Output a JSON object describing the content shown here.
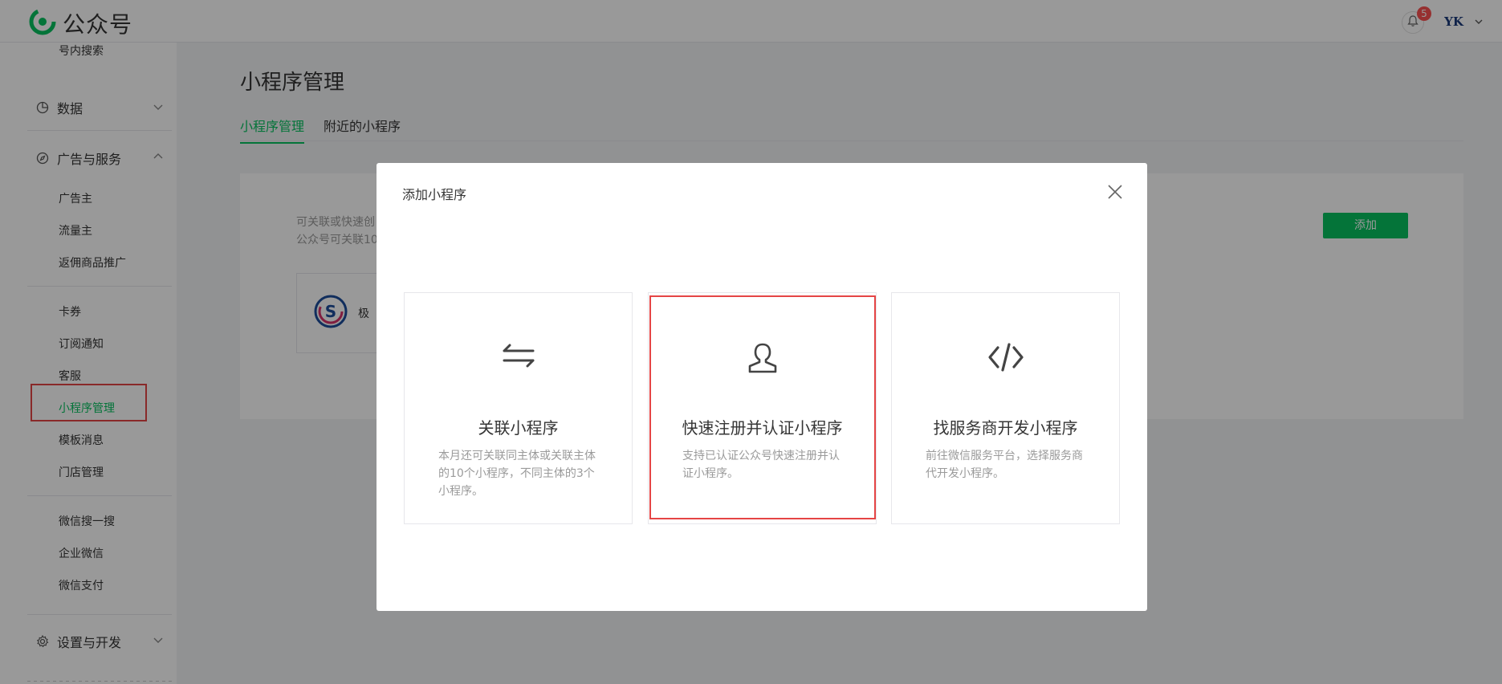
{
  "app": {
    "title": "公众号"
  },
  "header": {
    "notification_count": "5",
    "avatar_text": "YK"
  },
  "sidebar": {
    "top_item": "号内搜索",
    "groups": [
      {
        "label": "数据",
        "icon": "pie-chart-icon"
      },
      {
        "label": "广告与服务",
        "icon": "compass-icon"
      },
      {
        "label": "设置与开发",
        "icon": "gear-icon"
      }
    ],
    "items": [
      "广告主",
      "流量主",
      "返佣商品推广",
      "卡券",
      "订阅通知",
      "客服",
      "小程序管理",
      "模板消息",
      "门店管理",
      "微信搜一搜",
      "企业微信",
      "微信支付"
    ],
    "active_item": "小程序管理"
  },
  "main": {
    "title": "小程序管理",
    "tabs": [
      "小程序管理",
      "附近的小程序"
    ],
    "panel": {
      "desc_line1": "可关联或快速创",
      "desc_line2": "公众号可关联10",
      "add_button": "添加",
      "card_name": "极"
    }
  },
  "dialog": {
    "title": "添加小程序",
    "options": [
      {
        "title": "关联小程序",
        "desc": "本月还可关联同主体或关联主体的10个小程序，不同主体的3个小程序。",
        "icon": "swap-arrows-icon"
      },
      {
        "title": "快速注册并认证小程序",
        "desc": "支持已认证公众号快速注册并认证小程序。",
        "icon": "user-icon"
      },
      {
        "title": "找服务商开发小程序",
        "desc": "前往微信服务平台，选择服务商代开发小程序。",
        "icon": "code-icon"
      }
    ]
  },
  "colors": {
    "accent": "#07c160",
    "highlight": "#e54545",
    "badge": "#fa5151"
  }
}
